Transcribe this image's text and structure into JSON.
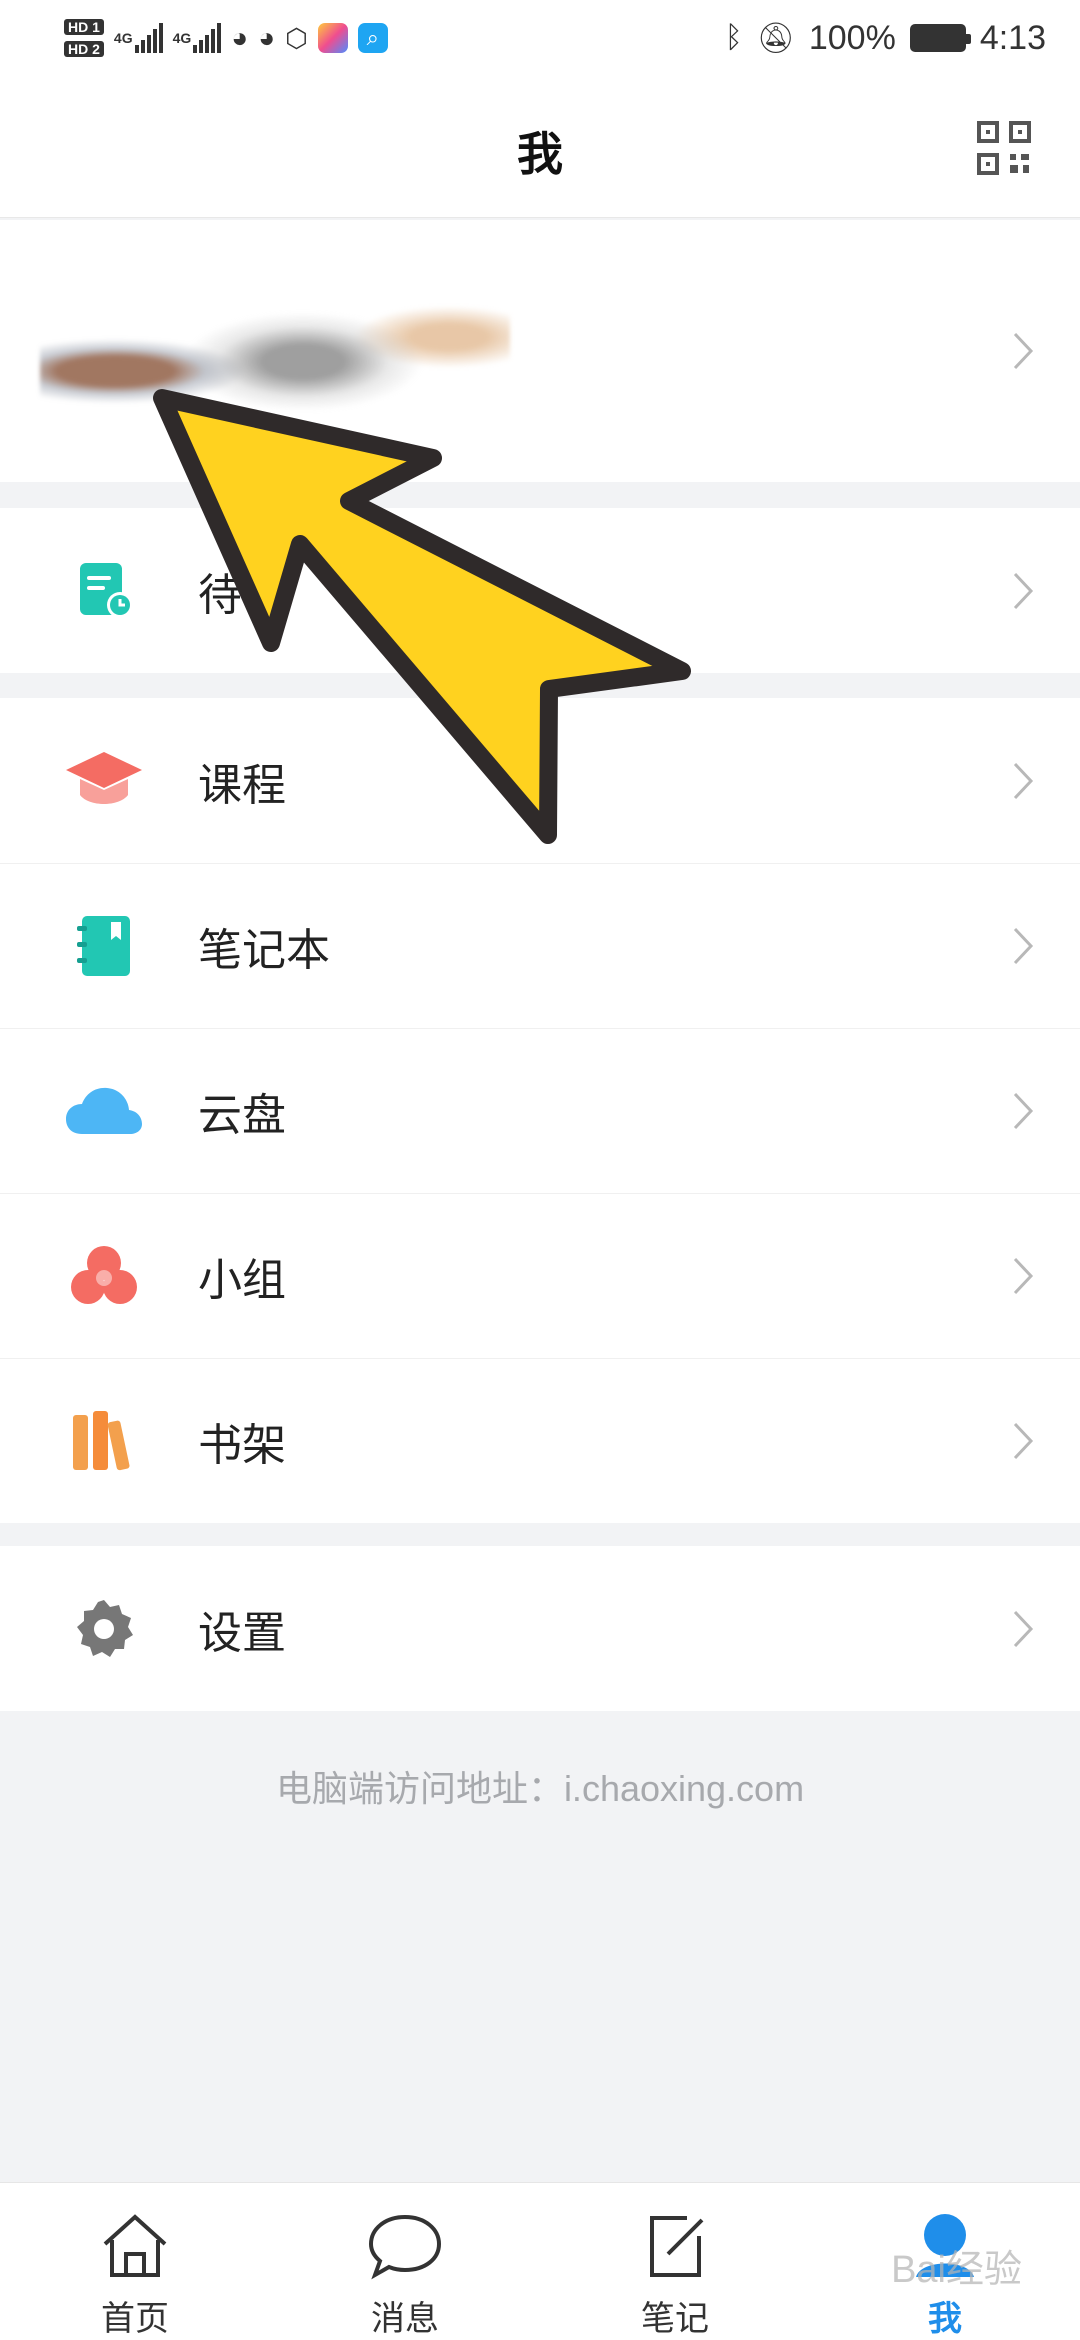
{
  "status_bar": {
    "network_labels": [
      "HD 1",
      "HD 2",
      "4G",
      "4G"
    ],
    "battery": "100%",
    "time": "4:13"
  },
  "header": {
    "title": "我",
    "qr_icon": "qr-code-icon"
  },
  "menu": {
    "todo": {
      "label": "待",
      "icon": "todo-list-icon"
    },
    "items": [
      {
        "label": "课程",
        "icon": "graduation-cap-icon",
        "color": "#f46c63"
      },
      {
        "label": "笔记本",
        "icon": "notebook-icon",
        "color": "#22c7b3"
      },
      {
        "label": "云盘",
        "icon": "cloud-icon",
        "color": "#4db6f5"
      },
      {
        "label": "小组",
        "icon": "group-icon",
        "color": "#f46c63"
      },
      {
        "label": "书架",
        "icon": "bookshelf-icon",
        "color": "#f3a04d"
      }
    ],
    "settings": {
      "label": "设置",
      "icon": "gear-icon"
    }
  },
  "footer": {
    "note": "电脑端访问地址：i.chaoxing.com"
  },
  "tabs": [
    {
      "label": "首页",
      "icon": "home-icon"
    },
    {
      "label": "消息",
      "icon": "message-icon"
    },
    {
      "label": "笔记",
      "icon": "note-edit-icon"
    },
    {
      "label": "我",
      "icon": "profile-icon",
      "active": true
    }
  ],
  "watermark": "Bai经验"
}
